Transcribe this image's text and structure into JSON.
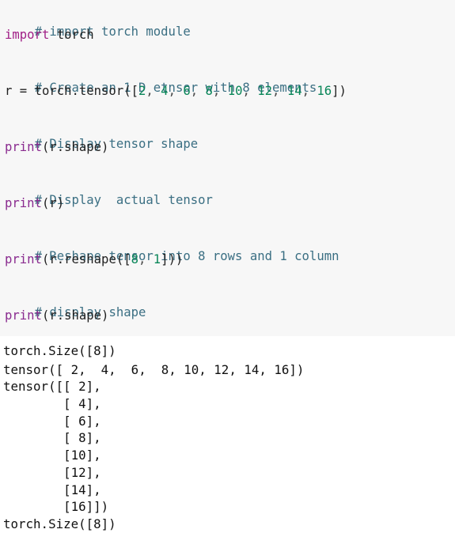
{
  "code_cell": {
    "lines": [
      {
        "comment": "# import torch module"
      },
      {
        "kw": "import",
        "rest": " torch"
      },
      {
        "comment": "# Create an 1 D etnsor with 8 elements"
      },
      {
        "lhs": "r = torch.tensor([",
        "nums": [
          "2",
          "4",
          "6",
          "8",
          "10",
          "12",
          "14",
          "16"
        ],
        "tail": "])"
      },
      {
        "comment": "# Display tensor shape"
      },
      {
        "fn": "print",
        "args": "(r.shape)"
      },
      {
        "comment": "# Display  actual tensor"
      },
      {
        "fn": "print",
        "args": "(r)"
      },
      {
        "comment": "# Reshape tensor into 8 rows and 1 column"
      },
      {
        "fn": "print",
        "args_pre": "(r.reshape([",
        "n1": "8",
        "sep": ", ",
        "n2": "1",
        "args_post": "]))"
      },
      {
        "comment": "# display shape"
      },
      {
        "fn": "print",
        "args": "(r.shape)"
      }
    ]
  },
  "output_cell": {
    "lines": [
      "torch.Size([8])",
      "tensor([ 2,  4,  6,  8, 10, 12, 14, 16])",
      "tensor([[ 2],",
      "        [ 4],",
      "        [ 6],",
      "        [ 8],",
      "        [10],",
      "        [12],",
      "        [14],",
      "        [16]])",
      "torch.Size([8])"
    ]
  }
}
